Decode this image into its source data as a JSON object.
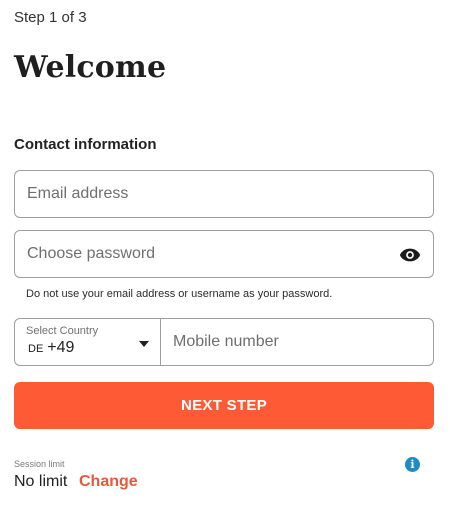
{
  "header": {
    "step_text": "Step 1 of 3",
    "title": "Welcome"
  },
  "contact": {
    "section_title": "Contact information",
    "email": {
      "placeholder": "Email address",
      "value": ""
    },
    "password": {
      "placeholder": "Choose password",
      "value": "",
      "toggle_icon": "eye-icon"
    },
    "password_hint": "Do not use your email address or username as your password.",
    "country": {
      "label": "Select Country",
      "code": "DE",
      "dial_code": "+49"
    },
    "mobile": {
      "placeholder": "Mobile number",
      "value": ""
    }
  },
  "actions": {
    "next_label": "NEXT STEP",
    "next_color": "#ff5a36"
  },
  "session": {
    "label": "Session limit",
    "value": "No limit",
    "change_label": "Change",
    "info_icon": "info-icon"
  }
}
